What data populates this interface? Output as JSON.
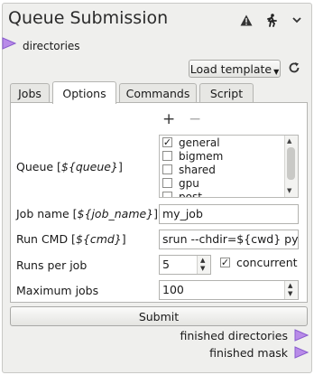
{
  "header": {
    "title": "Queue Submission"
  },
  "header_icons": [
    "warning-icon",
    "runner-icon",
    "chevron-down-icon"
  ],
  "input_port": {
    "label": "directories"
  },
  "toolbar": {
    "load_template_label": "Load template"
  },
  "tabs": [
    {
      "label": "Jobs",
      "active": false
    },
    {
      "label": "Options",
      "active": true
    },
    {
      "label": "Commands",
      "active": false
    },
    {
      "label": "Script",
      "active": false
    }
  ],
  "options": {
    "add_label": "+",
    "remove_label": "−",
    "queue": {
      "label": "Queue [",
      "var": "${queue}",
      "close": "]",
      "items": [
        {
          "name": "general",
          "checked": true
        },
        {
          "name": "bigmem",
          "checked": false
        },
        {
          "name": "shared",
          "checked": false
        },
        {
          "name": "gpu",
          "checked": false
        },
        {
          "name": "post",
          "checked": false
        }
      ]
    },
    "job_name": {
      "label": "Job name [",
      "var": "${job_name}",
      "close": "]",
      "value": "my_job"
    },
    "run_cmd": {
      "label": "Run CMD [",
      "var": "${cmd}",
      "close": "]",
      "value": "srun --chdir=${cwd} pyt"
    },
    "runs_per_job": {
      "label": "Runs per job",
      "value": "5",
      "concurrent_label": "concurrent",
      "concurrent_checked": true
    },
    "max_jobs": {
      "label": "Maximum jobs",
      "value": "100"
    }
  },
  "submit_label": "Submit",
  "output_ports": [
    {
      "label": "finished directories"
    },
    {
      "label": "finished mask"
    }
  ],
  "colors": {
    "port": "#b88be8",
    "port_border": "#8a5ccf",
    "panel": "#efefed"
  }
}
